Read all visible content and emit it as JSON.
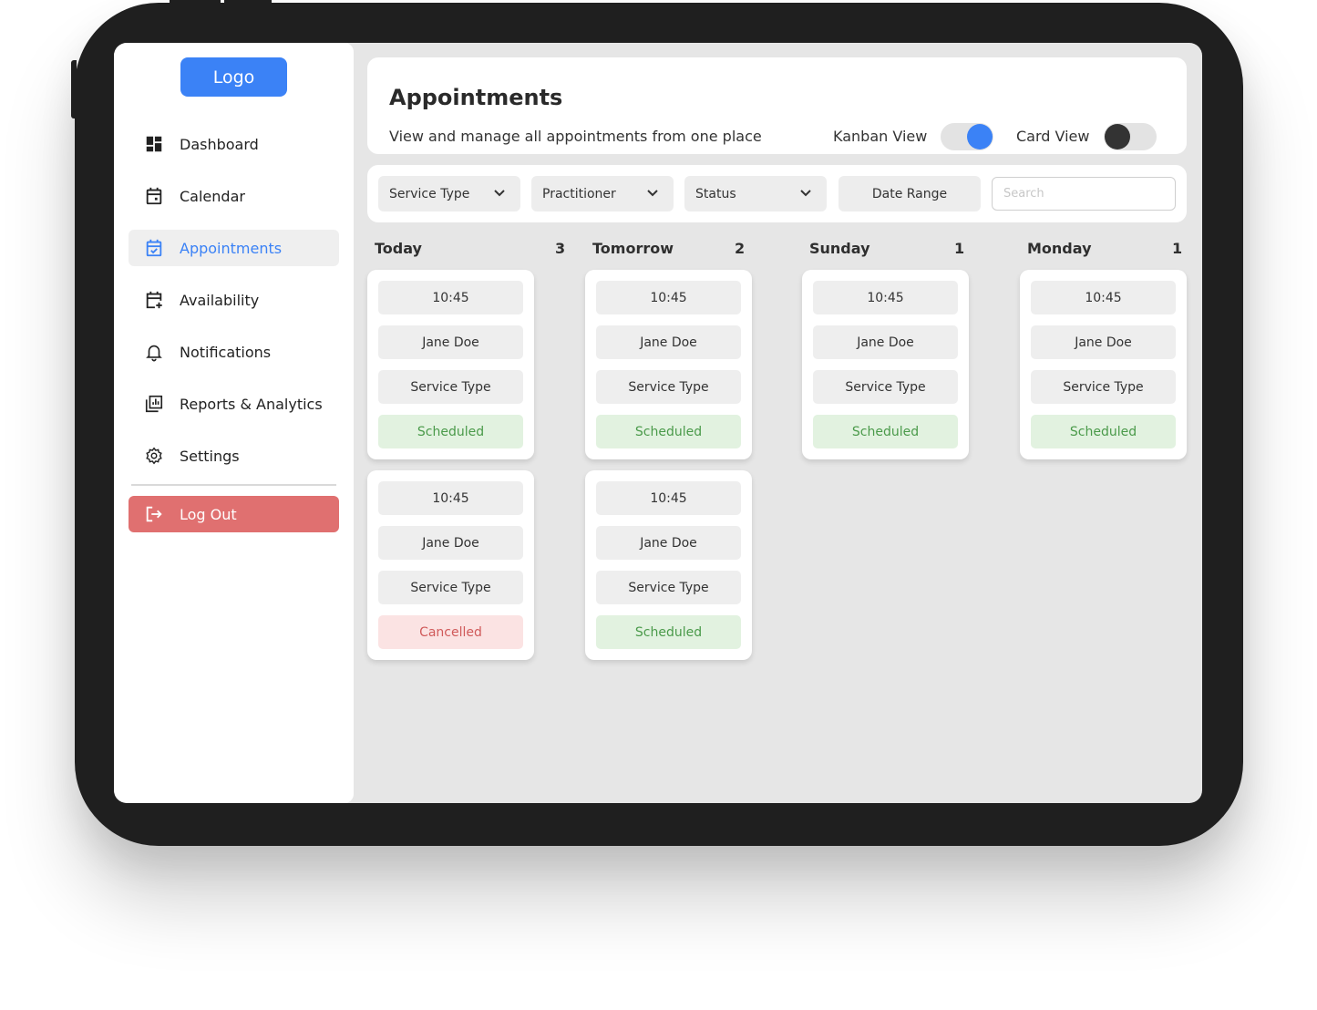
{
  "sidebar": {
    "logo": "Logo",
    "items": [
      {
        "label": "Dashboard",
        "icon": "dashboard-icon",
        "active": false
      },
      {
        "label": "Calendar",
        "icon": "calendar-icon",
        "active": false
      },
      {
        "label": "Appointments",
        "icon": "calendar-check-icon",
        "active": true
      },
      {
        "label": "Availability",
        "icon": "calendar-plus-icon",
        "active": false
      },
      {
        "label": "Notifications",
        "icon": "bell-icon",
        "active": false
      },
      {
        "label": "Reports & Analytics",
        "icon": "reports-icon",
        "active": false
      },
      {
        "label": "Settings",
        "icon": "gear-icon",
        "active": false
      }
    ],
    "logout": "Log Out"
  },
  "header": {
    "title": "Appointments",
    "subtitle": "View and manage all appointments from one place",
    "kanban_label": "Kanban View",
    "kanban_on": true,
    "card_label": "Card View",
    "card_on": false
  },
  "filters": {
    "service_type": "Service Type",
    "practitioner": "Practitioner",
    "status": "Status",
    "date_range": "Date Range",
    "search_placeholder": "Search"
  },
  "columns": [
    {
      "title": "Today",
      "count": "3",
      "cards": [
        {
          "time": "10:45",
          "name": "Jane Doe",
          "service": "Service Type",
          "status": "Scheduled",
          "kind": "scheduled"
        },
        {
          "time": "10:45",
          "name": "Jane Doe",
          "service": "Service Type",
          "status": "Cancelled",
          "kind": "cancelled"
        }
      ]
    },
    {
      "title": "Tomorrow",
      "count": "2",
      "cards": [
        {
          "time": "10:45",
          "name": "Jane Doe",
          "service": "Service Type",
          "status": "Scheduled",
          "kind": "scheduled"
        },
        {
          "time": "10:45",
          "name": "Jane Doe",
          "service": "Service Type",
          "status": "Scheduled",
          "kind": "scheduled"
        }
      ]
    },
    {
      "title": "Sunday",
      "count": "1",
      "cards": [
        {
          "time": "10:45",
          "name": "Jane Doe",
          "service": "Service Type",
          "status": "Scheduled",
          "kind": "scheduled"
        }
      ]
    },
    {
      "title": "Monday",
      "count": "1",
      "cards": [
        {
          "time": "10:45",
          "name": "Jane Doe",
          "service": "Service Type",
          "status": "Scheduled",
          "kind": "scheduled"
        }
      ]
    }
  ],
  "colors": {
    "accent": "#3b82f6",
    "logout": "#e07070",
    "scheduled_bg": "#e2f2e0",
    "scheduled_text": "#4a9a4a",
    "cancelled_bg": "#fbe3e3",
    "cancelled_text": "#d05a5a"
  }
}
